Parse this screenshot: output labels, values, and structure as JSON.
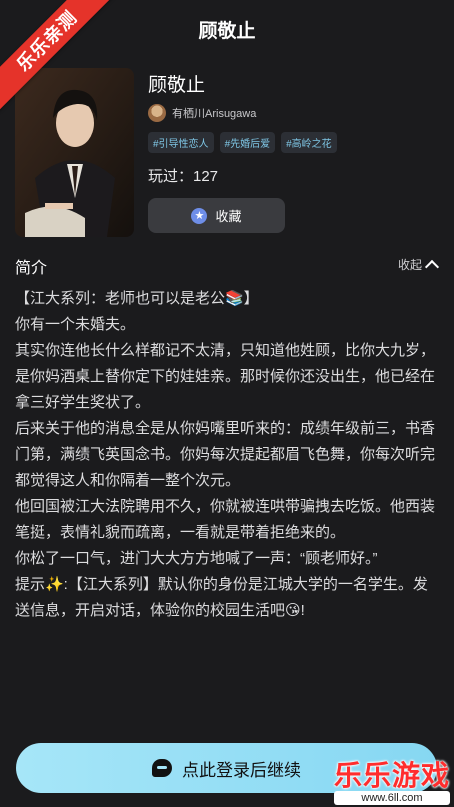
{
  "ribbon": {
    "text": "乐乐亲测"
  },
  "header": {
    "title": "顾敬止"
  },
  "character": {
    "name": "顾敬止",
    "author": "有栖川Arisugawa",
    "tags": [
      "#引导性恋人",
      "#先婚后爱",
      "#高岭之花"
    ],
    "plays": "玩过：127"
  },
  "favorite": {
    "label": "收藏",
    "icon": "star-icon"
  },
  "intro": {
    "title": "简介",
    "collapse_label": "收起",
    "lines": [
      "【江大系列：老师也可以是老公📚】",
      "你有一个未婚夫。",
      "其实你连他长什么样都记不太清，只知道他姓顾，比你大九岁，是你妈酒桌上替你定下的娃娃亲。那时候你还没出生，他已经在拿三好学生奖状了。",
      "后来关于他的消息全是从你妈嘴里听来的：成绩年级前三，书香门第，满绩飞英国念书。你妈每次提起都眉飞色舞，你每次听完都觉得这人和你隔着一整个次元。",
      "他回国被江大法院聘用不久，你就被连哄带骗拽去吃饭。他西装笔挺，表情礼貌而疏离，一看就是带着拒绝来的。",
      "你松了一口气，进门大大方方地喊了一声：“顾老师好。”",
      "提示✨:【江大系列】默认你的身份是江城大学的一名学生。发送信息，开启对话，体验你的校园生活吧😘!"
    ]
  },
  "login": {
    "label": "点此登录后继续"
  },
  "watermark": {
    "title": "乐乐游戏",
    "url": "www.6ll.com"
  }
}
